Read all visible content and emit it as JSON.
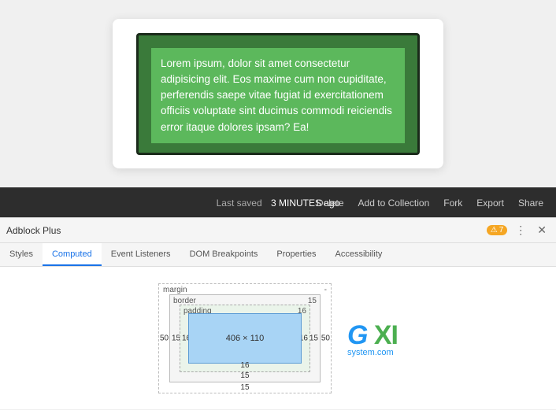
{
  "preview": {
    "text": "Lorem ipsum, dolor sit amet consectetur adipisicing elit. Eos maxime cum non cupiditate, perferendis saepe vitae fugiat id exercitationem officiis voluptate sint ducimus commodi reiciendis error itaque dolores ipsam? Ea!"
  },
  "toolbar": {
    "saved_label": "Last saved",
    "saved_time": "3 MINUTES ago",
    "btn_delete": "Delete",
    "btn_add_collection": "Add to Collection",
    "btn_fork": "Fork",
    "btn_export": "Export",
    "btn_share": "Share"
  },
  "devtools": {
    "title": "Adblock Plus",
    "warning_count": "7",
    "tabs": [
      {
        "id": "styles",
        "label": "Styles"
      },
      {
        "id": "computed",
        "label": "Computed"
      },
      {
        "id": "event-listeners",
        "label": "Event Listeners"
      },
      {
        "id": "dom-breakpoints",
        "label": "DOM Breakpoints"
      },
      {
        "id": "properties",
        "label": "Properties"
      },
      {
        "id": "accessibility",
        "label": "Accessibility"
      }
    ],
    "active_tab": "computed"
  },
  "box_model": {
    "margin_label": "margin",
    "margin_val": "-",
    "border_label": "border",
    "border_val": "15",
    "padding_label": "padding",
    "padding_val": "16",
    "content": "406 × 110",
    "top": "16",
    "bottom": "15",
    "left_outer": "50",
    "left_border": "15",
    "left_padding": "16",
    "right_padding": "16",
    "right_border": "15",
    "right_outer": "50"
  }
}
